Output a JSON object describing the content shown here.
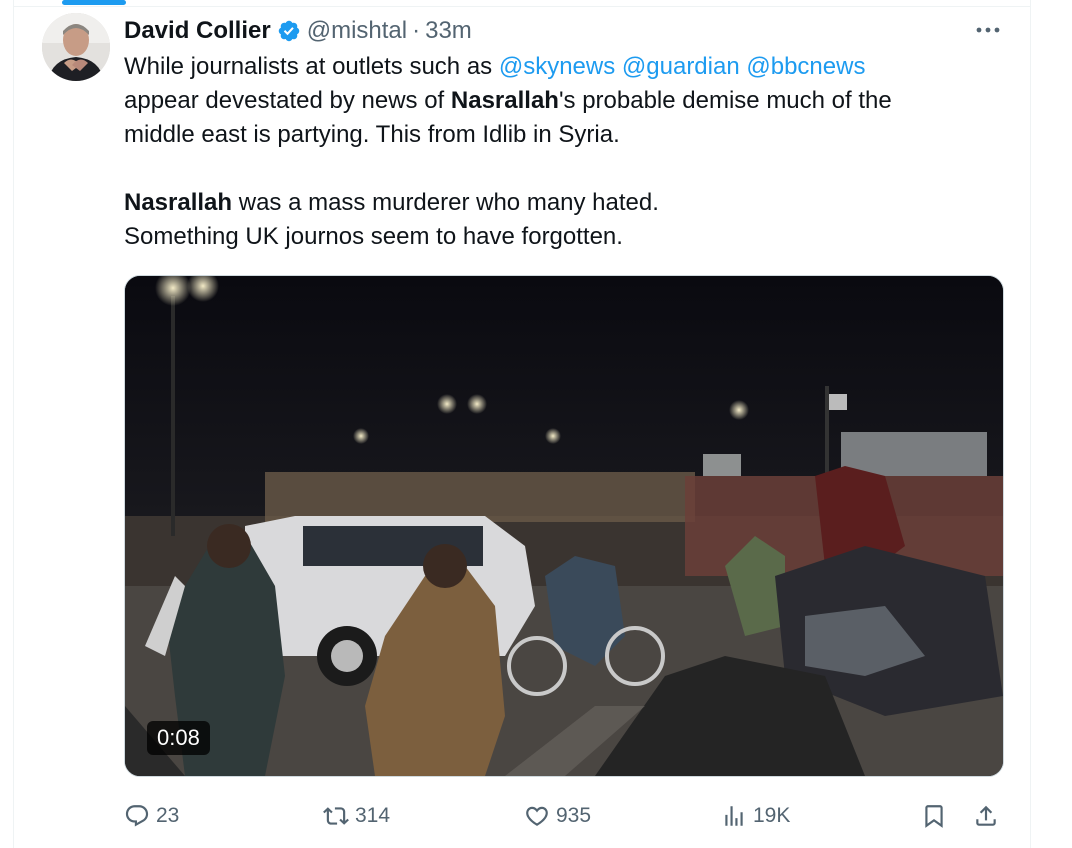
{
  "tweet": {
    "author": {
      "display_name": "David Collier",
      "handle": "@mishtal",
      "separator": "·",
      "time": "33m",
      "avatar": "author-photo",
      "verified": true
    },
    "text": {
      "line1_pre": "While journalists at outlets such as ",
      "mention1": "@skynews",
      "mention2": "@guardian",
      "mention3": "@bbcnews",
      "line2_pre": "appear devestated by news of ",
      "name_bold": "Nasrallah",
      "line2_post": "'s probable demise much of the",
      "line3": "middle east is partying. This from Idlib in Syria.",
      "line4_bold": "Nasrallah",
      "line4_post": " was a mass murderer who many hated.",
      "line5": "Something UK journos seem to have forgotten."
    },
    "media": {
      "type": "video",
      "duration": "0:08",
      "description_icon": "video-thumbnail"
    },
    "actions": {
      "replies": "23",
      "reposts": "314",
      "likes": "935",
      "views": "19K"
    }
  },
  "icons": {
    "reply": "reply-icon",
    "repost": "repost-icon",
    "like": "heart-icon",
    "views": "views-icon",
    "bookmark": "bookmark-icon",
    "share": "share-icon",
    "more": "more-icon",
    "verified": "verified-badge-icon"
  },
  "colors": {
    "accent": "#1d9bf0",
    "text": "#0f1419",
    "muted": "#536471",
    "border": "#cfd9de"
  }
}
